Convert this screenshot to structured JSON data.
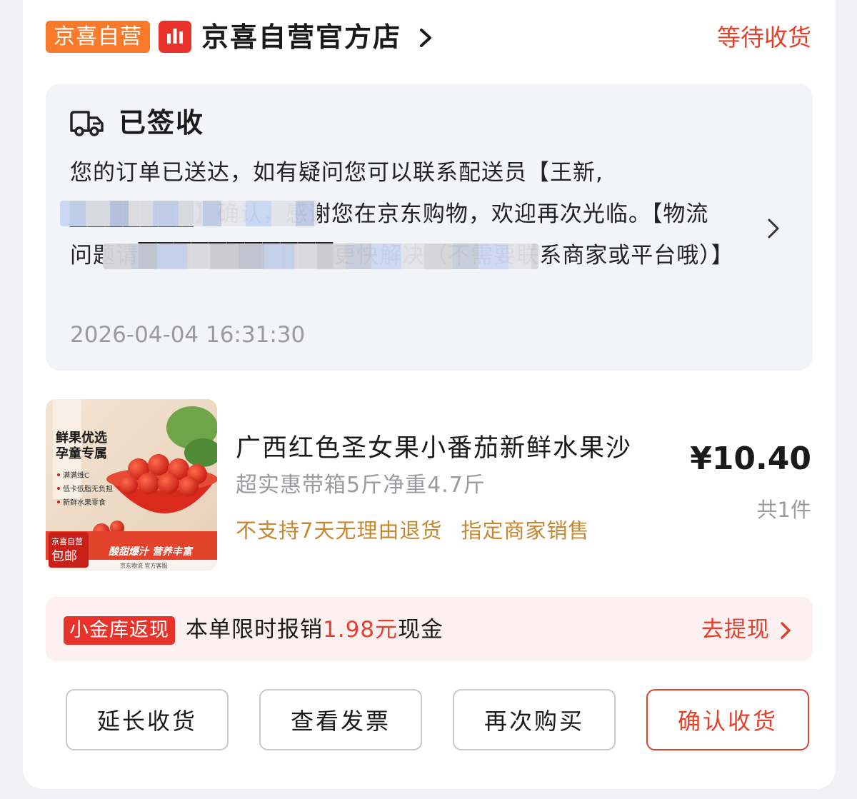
{
  "header": {
    "shop_badge": "京喜自营",
    "shop_name": "京喜自营官方店",
    "order_status": "等待收货"
  },
  "logistics": {
    "title": "已签收",
    "message": "您的订单已送达，如有疑问您可以联系配送员【王新, ███████】确认，感谢您在京东购物，欢迎再次光临。【物流问题请███████████更快解决（不需要联系商家或平台哦）】",
    "time": "2026-04-04 16:31:30"
  },
  "product": {
    "title": "广西红色圣女果小番茄新鲜水果沙",
    "spec": "超实惠带箱5斤净重4.7斤",
    "tags": [
      "不支持7天无理由退货",
      "指定商家销售"
    ],
    "price": "¥10.40",
    "quantity": "共1件",
    "image": {
      "headline_1": "鲜果优选",
      "headline_2": "孕童专属",
      "bullets": [
        "满满维C",
        "低卡低脂无负担",
        "新鲜水果零食"
      ],
      "corner_1": "京喜自营",
      "corner_2": "包邮",
      "slogan": "酸甜爆汁 营养丰富",
      "footer": "京东物流   官方客服"
    }
  },
  "cashback": {
    "badge": "小金库返现",
    "text_prefix": "本单限时报销",
    "amount": "1.98元",
    "text_suffix": "现金",
    "link": "去提现"
  },
  "actions": {
    "extend": "延长收货",
    "invoice": "查看发票",
    "rebuy": "再次购买",
    "confirm": "确认收货"
  },
  "colors": {
    "accent": "#e2422c",
    "shop_badge": "#f97a2a",
    "tag_text": "#c8872f",
    "logistics_bg": "#f3f4f8",
    "cashback_bg": "#fdf0f1"
  },
  "icons": {
    "shop_logo": "bar-chart-logo-icon",
    "shop_arrow": "chevron-right-icon",
    "logistics": "truck-icon",
    "logistics_arrow": "chevron-right-icon",
    "cashback_arrow": "chevron-right-icon"
  }
}
